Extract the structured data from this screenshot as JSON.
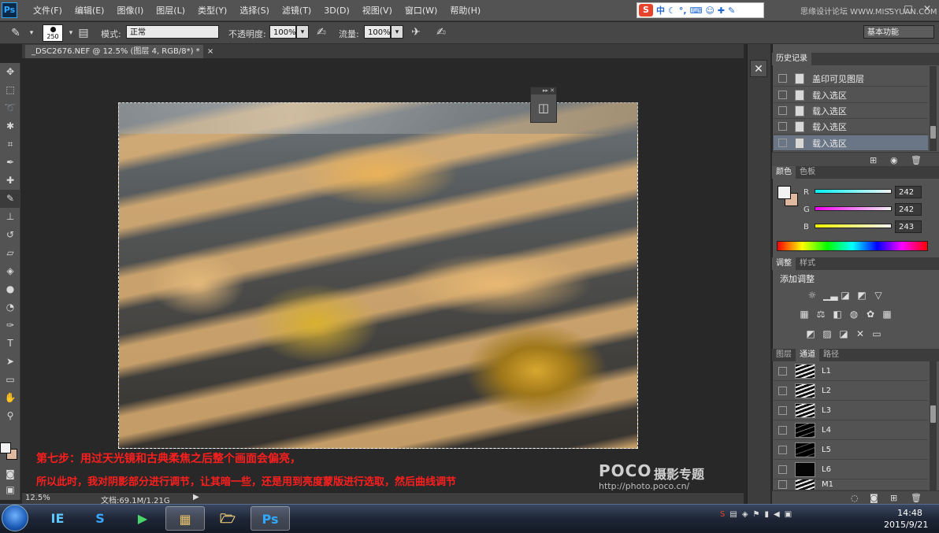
{
  "app": {
    "logo": "Ps"
  },
  "menu": [
    "文件(F)",
    "编辑(E)",
    "图像(I)",
    "图层(L)",
    "类型(Y)",
    "选择(S)",
    "滤镜(T)",
    "3D(D)",
    "视图(V)",
    "窗口(W)",
    "帮助(H)"
  ],
  "ime": {
    "label": "中",
    "s": "S"
  },
  "watermark": "思缘设计论坛 WWW.MISSYUAN.COM",
  "window_buttons": [
    "–",
    "□",
    "✕"
  ],
  "options": {
    "brush_size": "250",
    "mode_label": "模式:",
    "mode_value": "正常",
    "opacity_label": "不透明度:",
    "opacity_value": "100%",
    "flow_label": "流量:",
    "flow_value": "100%",
    "workspace": "基本功能"
  },
  "document": {
    "tab_title": "_DSC2676.NEF @ 12.5% (图层 4, RGB/8*) *",
    "tab_close": "×",
    "zoom": "12.5%",
    "doc_info": "文档:69.1M/1.21G"
  },
  "captions": {
    "line1": "第七步：用过天光镜和古典柔焦之后整个画面会偏亮，",
    "line2": "所以此时，我对阴影部分进行调节，让其暗一些，还是用到亮度蒙版进行选取，然后曲线调节"
  },
  "poco": {
    "brand": "POCO",
    "title": "摄影专题",
    "url": "http://photo.poco.cn/"
  },
  "history": {
    "tab": "历史记录",
    "rows": [
      {
        "label": "盖印可见图层",
        "selected": false
      },
      {
        "label": "载入选区",
        "selected": false
      },
      {
        "label": "载入选区",
        "selected": false
      },
      {
        "label": "载入选区",
        "selected": false
      },
      {
        "label": "载入选区",
        "selected": true
      }
    ]
  },
  "color": {
    "tabs": [
      "颜色",
      "色板"
    ],
    "channels": [
      {
        "name": "R",
        "value": "242"
      },
      {
        "name": "G",
        "value": "242"
      },
      {
        "name": "B",
        "value": "243"
      }
    ],
    "fg": "#f2f2f3",
    "bg": "#dfb8a0"
  },
  "adjustments": {
    "tabs": [
      "调整",
      "样式"
    ],
    "title": "添加调整"
  },
  "channels_panel": {
    "tabs": [
      "图层",
      "通道",
      "路径"
    ],
    "rows": [
      "L1",
      "L2",
      "L3",
      "L4",
      "L5",
      "L6",
      "M1"
    ]
  },
  "taskbar": {
    "items": [
      "IE",
      "S",
      "▶",
      "▦",
      "🗁",
      "Ps"
    ],
    "time": "14:48",
    "date": "2015/9/21"
  }
}
